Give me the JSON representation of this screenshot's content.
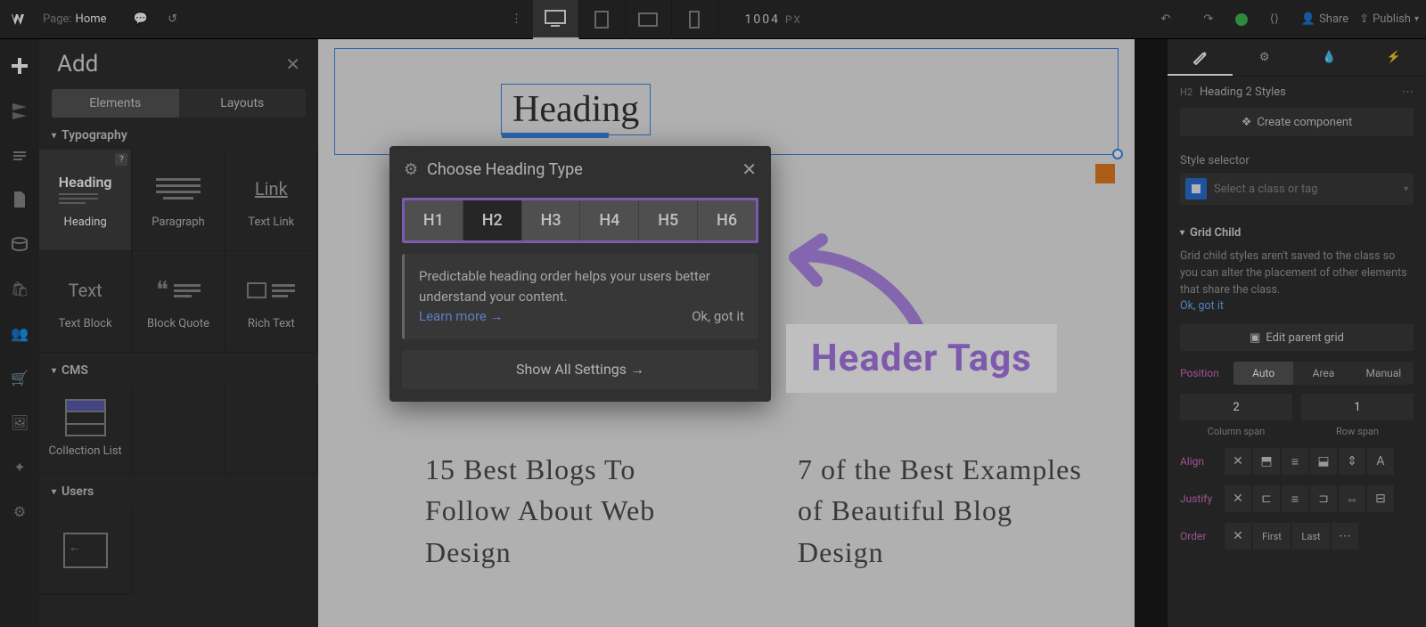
{
  "topbar": {
    "page_prefix": "Page:",
    "page_name": "Home",
    "width_value": "1004",
    "width_unit": "PX",
    "share": "Share",
    "publish": "Publish"
  },
  "add_panel": {
    "title": "Add",
    "tabs": {
      "elements": "Elements",
      "layouts": "Layouts"
    },
    "sections": {
      "typography": "Typography",
      "cms": "CMS",
      "users": "Users"
    },
    "elements": {
      "heading_big": "Heading",
      "heading": "Heading",
      "paragraph": "Paragraph",
      "textlink": "Text Link",
      "link_big": "Link",
      "text_big": "Text",
      "textblock": "Text Block",
      "blockquote": "Block Quote",
      "richtext": "Rich Text",
      "collection_list": "Collection List"
    }
  },
  "canvas": {
    "heading_text": "Heading",
    "blog1_title": "15 Best Blogs To Follow About Web Design",
    "blog2_title": "7 of the Best Examples of Beautiful Blog Design"
  },
  "popover": {
    "title": "Choose Heading Type",
    "h": [
      "H1",
      "H2",
      "H3",
      "H4",
      "H5",
      "H6"
    ],
    "selected": 1,
    "info": "Predictable heading order helps your users better understand your content.",
    "learn_more": "Learn more →",
    "ok": "Ok, got it",
    "show_all": "Show All Settings"
  },
  "callout": "Header Tags",
  "right_panel": {
    "heading_badge": "H2",
    "heading_label": "Heading 2 Styles",
    "create_component": "Create component",
    "style_selector_label": "Style selector",
    "style_placeholder": "Select a class or tag",
    "grid_child": "Grid Child",
    "gc_note": "Grid child styles aren't saved to the class so you can alter the placement of other elements that share the class.",
    "gc_ok": "Ok, got it",
    "edit_parent": "Edit parent grid",
    "pos_label": "Position",
    "pos_auto": "Auto",
    "pos_area": "Area",
    "pos_manual": "Manual",
    "col_span": "2",
    "row_span": "1",
    "col_span_lbl": "Column span",
    "row_span_lbl": "Row span",
    "align": "Align",
    "justify": "Justify",
    "order": "Order",
    "first": "First",
    "last": "Last"
  }
}
